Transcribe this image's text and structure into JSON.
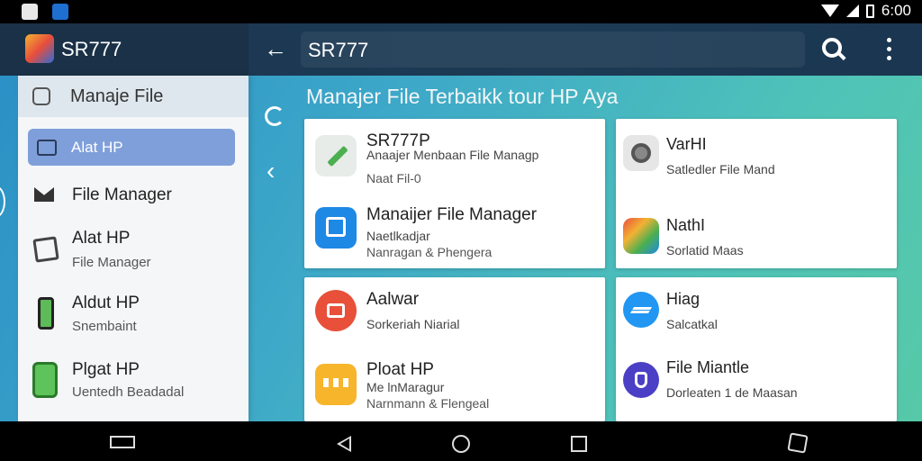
{
  "status_bar": {
    "time": "6:00"
  },
  "app_bar": {
    "app_title": "SR777",
    "search_text": "SR777"
  },
  "drawer": {
    "header_label": "Manaje File",
    "active_item": "Alat HP",
    "items": [
      {
        "title": "File Manager",
        "subtitle": ""
      },
      {
        "title": "Alat HP",
        "subtitle": "File Manager"
      },
      {
        "title": "Aldut HP",
        "subtitle": "Snembaint"
      },
      {
        "title": "Plgat HP",
        "subtitle": "Uentedh Beadadal"
      }
    ]
  },
  "main": {
    "section_title": "Manajer File Terbaikk tour HP Aya",
    "cards": [
      {
        "items": [
          {
            "title": "SR777P",
            "line1": "Anaajer Menbaan File Managp",
            "line2": "Naat Fil-0",
            "icon": "pencil-icon",
            "icon_color": "#4caf50"
          },
          {
            "title": "Manaijer File Manager",
            "line1": "Naetlkadjar",
            "line2": "Nanragan & Phengera",
            "icon": "file-manager-icon",
            "icon_color": "#1e88e5"
          }
        ]
      },
      {
        "items": [
          {
            "title": "VarHI",
            "line1": "Satledler File Mand",
            "line2": "",
            "icon": "camera-icon",
            "icon_color": "#9e9e9e"
          },
          {
            "title": "NathI",
            "line1": "Sorlatid Maas",
            "line2": "",
            "icon": "folder-icon",
            "icon_color": "#f2b233"
          }
        ]
      },
      {
        "items": [
          {
            "title": "Aalwar",
            "line1": "Sorkeriah Niarial",
            "line2": "",
            "icon": "media-icon",
            "icon_color": "#e8503a"
          },
          {
            "title": "Ploat HP",
            "line1": "Me lnMaragur",
            "line2": "Narnmann & Flengeal",
            "icon": "grid-icon",
            "icon_color": "#f7b52c"
          }
        ]
      },
      {
        "items": [
          {
            "title": "Hiag",
            "line1": "Salcatkal",
            "line2": "",
            "icon": "messenger-icon",
            "icon_color": "#2196f3"
          },
          {
            "title": "File Miantle",
            "line1": "Dorleaten 1 de Maasan",
            "line2": "",
            "icon": "shield-icon",
            "icon_color": "#4a3fc5"
          }
        ]
      }
    ]
  }
}
